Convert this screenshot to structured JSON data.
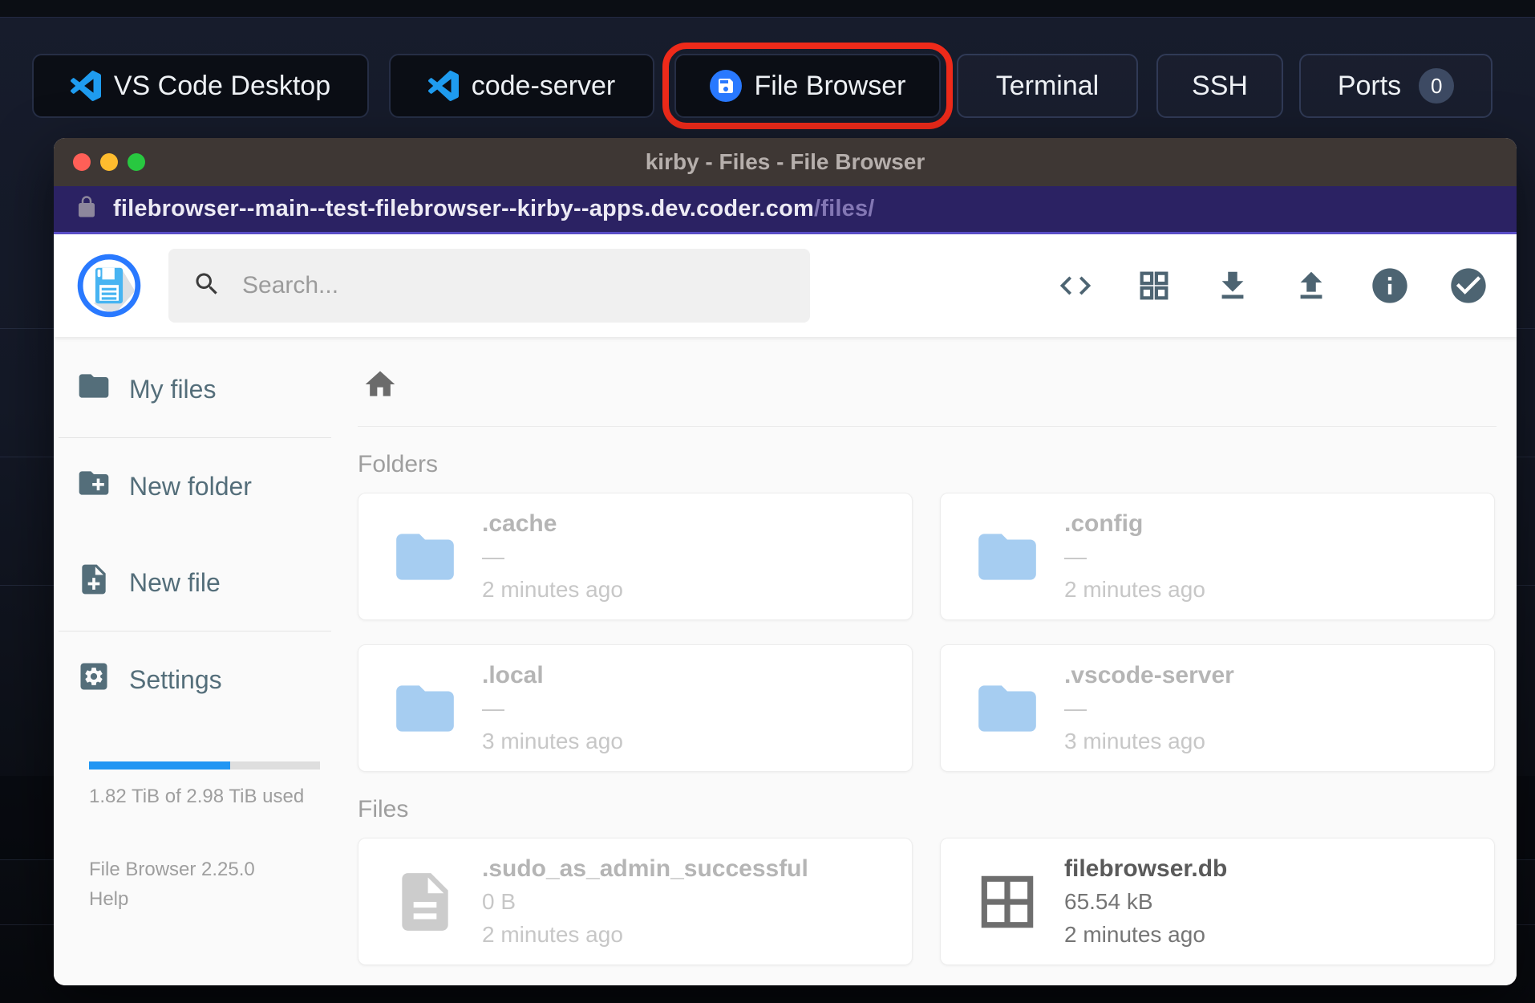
{
  "colors": {
    "accent_blue": "#2979ff",
    "progress_blue": "#2196F3",
    "highlight_red": "#ee2a1a",
    "icon_slate": "#546e7a",
    "folder_blue": "#a6cdf1",
    "titlebar_bg": "#3e3734",
    "url_bar_bg": "#2b2263",
    "traffic_lights": [
      "#ff5f57",
      "#febc2e",
      "#28c840"
    ]
  },
  "top_bar": {
    "tabs": [
      {
        "label": "VS Code Desktop"
      },
      {
        "label": "code-server"
      },
      {
        "label": "File Browser",
        "highlighted": true
      },
      {
        "label": "Terminal"
      },
      {
        "label": "SSH"
      },
      {
        "label": "Ports",
        "badge": "0"
      }
    ]
  },
  "window": {
    "title": "kirby - Files - File Browser",
    "url_domain": "filebrowser--main--test-filebrowser--kirby--apps.dev.coder.com",
    "url_path": "/files/"
  },
  "toolbar": {
    "search_placeholder": "Search...",
    "icons": [
      "raw-view",
      "switch-view",
      "download",
      "upload",
      "info",
      "select-multiple"
    ]
  },
  "sidebar": {
    "items": [
      {
        "label": "My files"
      },
      {
        "label": "New folder"
      },
      {
        "label": "New file"
      },
      {
        "label": "Settings"
      }
    ],
    "usage_percent": 61,
    "usage_label": "1.82 TiB of 2.98 TiB used",
    "version": "File Browser 2.25.0",
    "help_label": "Help"
  },
  "content": {
    "sections": [
      {
        "title": "Folders",
        "items": [
          {
            "name": ".cache",
            "size": "—",
            "time": "2 minutes ago"
          },
          {
            "name": ".config",
            "size": "—",
            "time": "2 minutes ago"
          },
          {
            "name": ".local",
            "size": "—",
            "time": "3 minutes ago"
          },
          {
            "name": ".vscode-server",
            "size": "—",
            "time": "3 minutes ago"
          }
        ]
      },
      {
        "title": "Files",
        "items": [
          {
            "name": ".sudo_as_admin_successful",
            "size": "0 B",
            "time": "2 minutes ago"
          },
          {
            "name": "filebrowser.db",
            "size": "65.54 kB",
            "time": "2 minutes ago"
          }
        ]
      }
    ]
  }
}
